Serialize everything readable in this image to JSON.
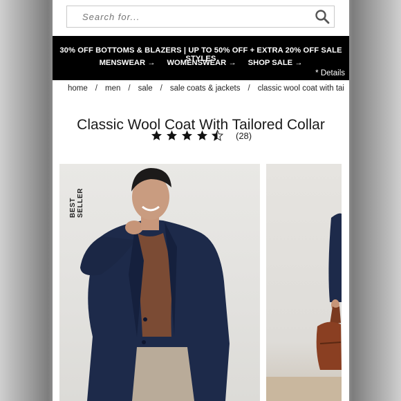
{
  "search": {
    "placeholder": "Search for..."
  },
  "promo": {
    "headline": "30% OFF BOTTOMS & BLAZERS | UP TO 50% OFF + EXTRA 20% OFF SALE STYLES",
    "links": [
      {
        "label": "MENSWEAR →"
      },
      {
        "label": "WOMENSWEAR →"
      },
      {
        "label": "SHOP SALE →"
      }
    ],
    "details": "* Details"
  },
  "breadcrumb": {
    "items": [
      "home",
      "men",
      "sale",
      "sale coats & jackets",
      "classic wool coat with tai"
    ],
    "separator": "/"
  },
  "product": {
    "title": "Classic Wool Coat With Tailored Collar",
    "rating": 4.5,
    "rating_max": 5,
    "review_count": "(28)",
    "badge": "BEST SELLER"
  },
  "colors": {
    "promo_bg": "#000000",
    "page_bg": "#ffffff"
  }
}
